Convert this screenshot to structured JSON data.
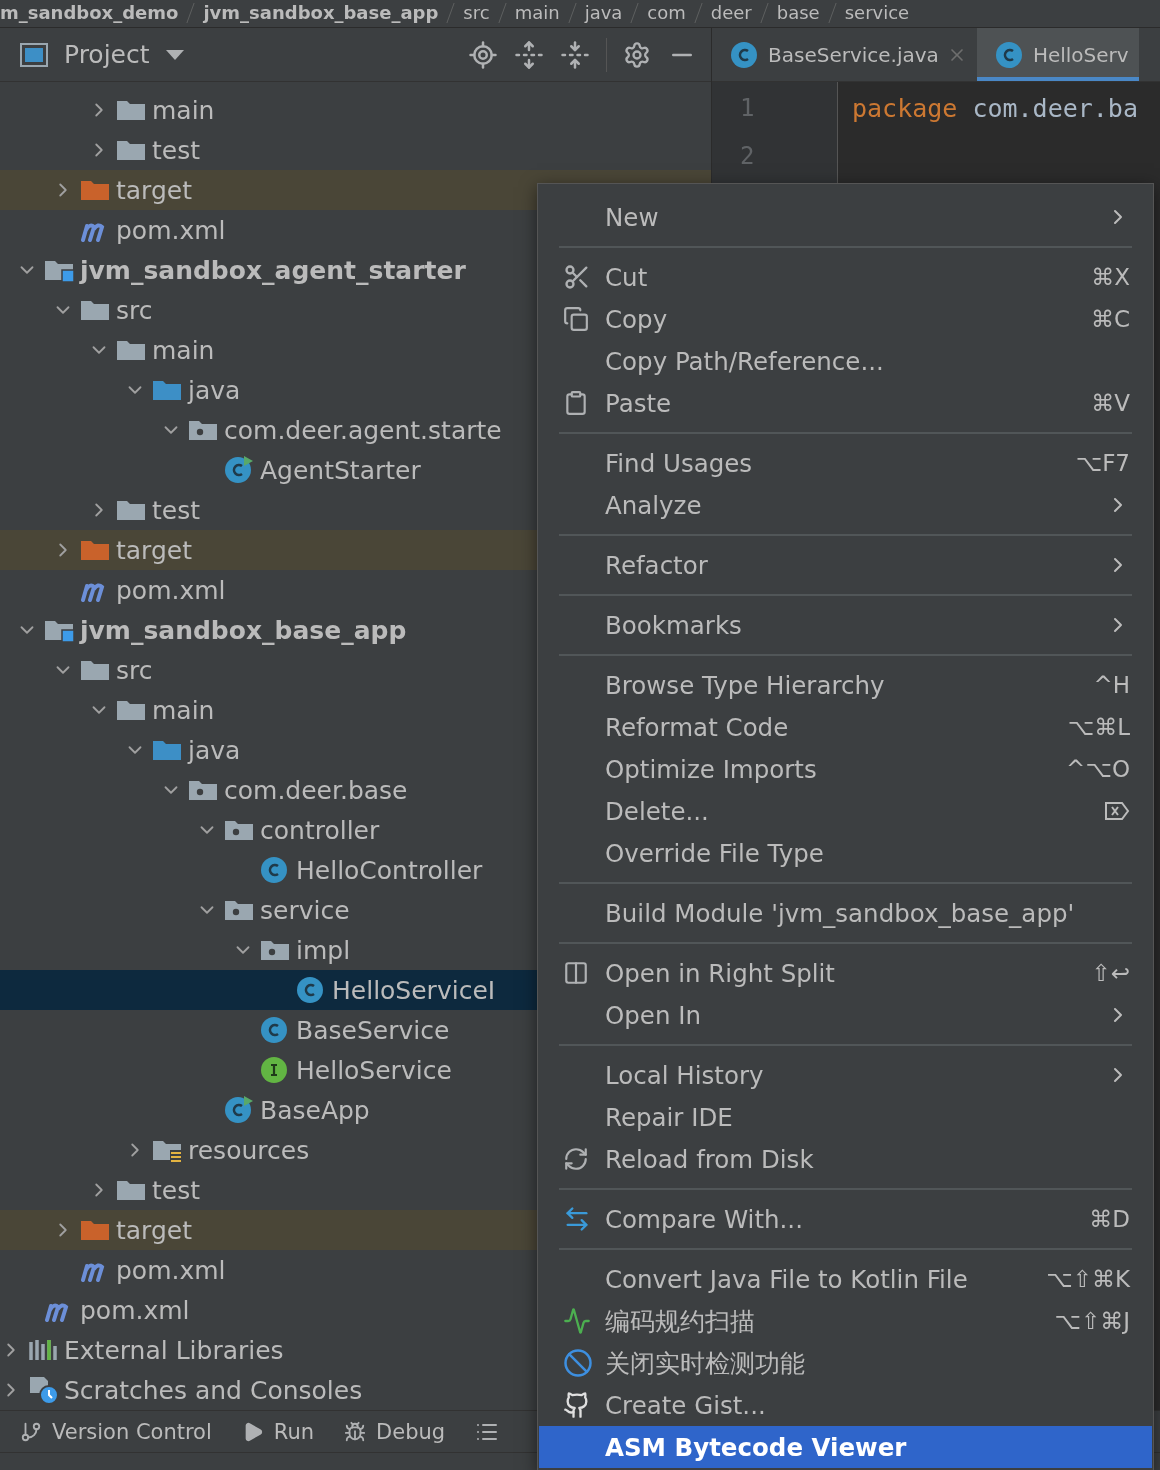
{
  "breadcrumb": [
    "m_sandbox_demo",
    "jvm_sandbox_base_app",
    "src",
    "main",
    "java",
    "com",
    "deer",
    "base",
    "service"
  ],
  "project_panel": {
    "title": "Project"
  },
  "tree": [
    {
      "children": [
        {
          "children": [
            {
              "children": [
                {
                  "label": "main",
                  "kind": "folder",
                  "expanded": false,
                  "selected": false
                },
                {
                  "label": "test",
                  "kind": "folder",
                  "expanded": false,
                  "selected": false
                }
              ]
            },
            {
              "label": "target",
              "kind": "excluded",
              "expanded": false,
              "selected": false
            },
            {
              "label": "pom.xml",
              "kind": "maven",
              "selected": false
            }
          ]
        },
        {
          "label": "jvm_sandbox_agent_starter",
          "kind": "module",
          "expanded": true,
          "selected": false,
          "children": [
            {
              "label": "src",
              "kind": "folder",
              "expanded": true,
              "selected": false,
              "children": [
                {
                  "label": "main",
                  "kind": "folder",
                  "expanded": true,
                  "selected": false,
                  "children": [
                    {
                      "label": "java",
                      "kind": "source",
                      "expanded": true,
                      "selected": false,
                      "children": [
                        {
                          "label": "com.deer.agent.starte",
                          "kind": "package",
                          "expanded": true,
                          "selected": false,
                          "children": [
                            {
                              "label": "AgentStarter",
                              "kind": "runnable",
                              "selected": false
                            }
                          ]
                        }
                      ]
                    }
                  ]
                },
                {
                  "label": "test",
                  "kind": "folder",
                  "expanded": false,
                  "selected": false
                }
              ]
            },
            {
              "label": "target",
              "kind": "excluded",
              "expanded": false,
              "selected": false
            },
            {
              "label": "pom.xml",
              "kind": "maven",
              "selected": false
            }
          ]
        },
        {
          "label": "jvm_sandbox_base_app",
          "kind": "module",
          "expanded": true,
          "selected": false,
          "children": [
            {
              "label": "src",
              "kind": "folder",
              "expanded": true,
              "selected": false,
              "children": [
                {
                  "label": "main",
                  "kind": "folder",
                  "expanded": true,
                  "selected": false,
                  "children": [
                    {
                      "label": "java",
                      "kind": "source",
                      "expanded": true,
                      "selected": false,
                      "children": [
                        {
                          "label": "com.deer.base",
                          "kind": "package",
                          "expanded": true,
                          "selected": false,
                          "children": [
                            {
                              "label": "controller",
                              "kind": "package",
                              "expanded": true,
                              "selected": false,
                              "children": [
                                {
                                  "label": "HelloController",
                                  "kind": "class",
                                  "selected": false
                                }
                              ]
                            },
                            {
                              "label": "service",
                              "kind": "package",
                              "expanded": true,
                              "selected": false,
                              "children": [
                                {
                                  "label": "impl",
                                  "kind": "package",
                                  "expanded": true,
                                  "selected": false,
                                  "children": [
                                    {
                                      "label": "HelloServiceI",
                                      "kind": "class",
                                      "selected": true
                                    }
                                  ]
                                },
                                {
                                  "label": "BaseService",
                                  "kind": "class",
                                  "selected": false
                                },
                                {
                                  "label": "HelloService",
                                  "kind": "interface",
                                  "selected": false
                                }
                              ]
                            },
                            {
                              "label": "BaseApp",
                              "kind": "runnable",
                              "selected": false
                            }
                          ]
                        }
                      ]
                    },
                    {
                      "label": "resources",
                      "kind": "resources",
                      "expanded": false,
                      "selected": false
                    }
                  ]
                },
                {
                  "label": "test",
                  "kind": "folder",
                  "expanded": false,
                  "selected": false
                }
              ]
            },
            {
              "label": "target",
              "kind": "excluded",
              "expanded": false,
              "selected": false
            },
            {
              "label": "pom.xml",
              "kind": "maven",
              "selected": false
            }
          ]
        },
        {
          "label": "pom.xml",
          "kind": "maven",
          "selected": false
        }
      ]
    },
    {
      "label": "External Libraries",
      "kind": "libraries",
      "expanded": false,
      "selected": false
    },
    {
      "label": "Scratches and Consoles",
      "kind": "scratches",
      "expanded": false,
      "selected": false
    }
  ],
  "editor": {
    "tabs": [
      {
        "label": "BaseService.java",
        "selected": false
      },
      {
        "label": "HelloServ",
        "selected": true
      }
    ],
    "lines": [
      {
        "number": "1",
        "tokens": [
          {
            "kind": "keyword",
            "text": "package"
          },
          {
            "kind": "plain",
            "text": " com.deer.ba"
          }
        ]
      },
      {
        "number": "2"
      }
    ]
  },
  "tool_windows": [
    {
      "label": "Version Control",
      "kind": "vcs"
    },
    {
      "label": "Run",
      "kind": "run"
    },
    {
      "label": "Debug",
      "kind": "debug"
    },
    {
      "kind": "list"
    }
  ],
  "context_menu": [
    {
      "kind": "plain",
      "label": "New",
      "submenu": true,
      "selected": false
    },
    {
      "kind": "separator"
    },
    {
      "kind": "cut",
      "label": "Cut",
      "shortcut": "⌘X",
      "submenu": false,
      "selected": false
    },
    {
      "kind": "copy",
      "label": "Copy",
      "shortcut": "⌘C",
      "submenu": false,
      "selected": false
    },
    {
      "kind": "plain",
      "label": "Copy Path/Reference...",
      "submenu": false,
      "selected": false
    },
    {
      "kind": "paste",
      "label": "Paste",
      "shortcut": "⌘V",
      "submenu": false,
      "selected": false
    },
    {
      "kind": "separator"
    },
    {
      "kind": "plain",
      "label": "Find Usages",
      "shortcut": "⌥F7",
      "submenu": false,
      "selected": false
    },
    {
      "kind": "plain",
      "label": "Analyze",
      "submenu": true,
      "selected": false
    },
    {
      "kind": "separator"
    },
    {
      "kind": "plain",
      "label": "Refactor",
      "submenu": true,
      "selected": false
    },
    {
      "kind": "separator"
    },
    {
      "kind": "plain",
      "label": "Bookmarks",
      "submenu": true,
      "selected": false
    },
    {
      "kind": "separator"
    },
    {
      "kind": "plain",
      "label": "Browse Type Hierarchy",
      "shortcut": "^H",
      "submenu": false,
      "selected": false
    },
    {
      "kind": "plain",
      "label": "Reformat Code",
      "shortcut": "⌥⌘L",
      "submenu": false,
      "selected": false
    },
    {
      "kind": "plain",
      "label": "Optimize Imports",
      "shortcut": "^⌥O",
      "submenu": false,
      "selected": false
    },
    {
      "kind": "delete",
      "label": "Delete...",
      "submenu": false,
      "selected": false
    },
    {
      "kind": "plain",
      "label": "Override File Type",
      "submenu": false,
      "selected": false
    },
    {
      "kind": "separator"
    },
    {
      "kind": "plain",
      "label": "Build Module 'jvm_sandbox_base_app'",
      "submenu": false,
      "selected": false
    },
    {
      "kind": "separator"
    },
    {
      "kind": "split",
      "label": "Open in Right Split",
      "shortcut": "⇧↩",
      "submenu": false,
      "selected": false
    },
    {
      "kind": "plain",
      "label": "Open In",
      "submenu": true,
      "selected": false
    },
    {
      "kind": "separator"
    },
    {
      "kind": "plain",
      "label": "Local History",
      "submenu": true,
      "selected": false
    },
    {
      "kind": "plain",
      "label": "Repair IDE",
      "submenu": false,
      "selected": false
    },
    {
      "kind": "reload",
      "label": "Reload from Disk",
      "submenu": false,
      "selected": false
    },
    {
      "kind": "separator"
    },
    {
      "kind": "compare",
      "label": "Compare With...",
      "shortcut": "⌘D",
      "submenu": false,
      "selected": false
    },
    {
      "kind": "separator"
    },
    {
      "kind": "plain",
      "label": "Convert Java File to Kotlin File",
      "shortcut": "⌥⇧⌘K",
      "submenu": false,
      "selected": false
    },
    {
      "kind": "scan",
      "label": "编码规约扫描",
      "shortcut": "⌥⇧⌘J",
      "submenu": false,
      "selected": false
    },
    {
      "kind": "inspection",
      "label": "关闭实时检测功能",
      "submenu": false,
      "selected": false
    },
    {
      "kind": "gist",
      "label": "Create Gist...",
      "submenu": false,
      "selected": false
    },
    {
      "kind": "plain",
      "label": "ASM Bytecode Viewer",
      "submenu": false,
      "selected": true
    }
  ]
}
